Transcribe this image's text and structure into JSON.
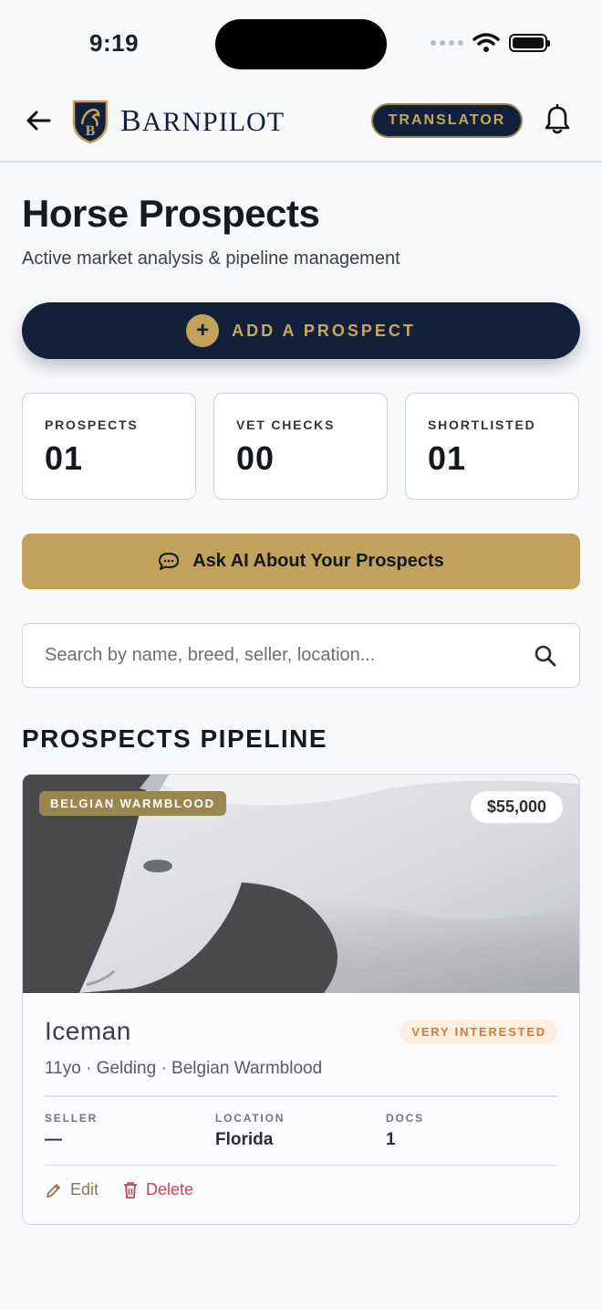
{
  "status_bar": {
    "time": "9:19"
  },
  "header": {
    "logo_text": "BarnPilot",
    "logo_text_first": "B",
    "logo_text_rest": "ARNPILOT",
    "translator_label": "TRANSLATOR",
    "icons": {
      "back": "arrow-left-icon",
      "notifications": "bell-icon",
      "logo": "crest-icon"
    }
  },
  "page": {
    "title": "Horse Prospects",
    "subtitle": "Active market analysis & pipeline management"
  },
  "add_button": {
    "label": "ADD A PROSPECT",
    "icon": "plus-circle-icon"
  },
  "stats": [
    {
      "label": "PROSPECTS",
      "value": "01"
    },
    {
      "label": "VET CHECKS",
      "value": "00"
    },
    {
      "label": "SHORTLISTED",
      "value": "01"
    }
  ],
  "ai_button": {
    "label": "Ask AI About Your Prospects",
    "icon": "chat-bubble-icon"
  },
  "search": {
    "placeholder": "Search by name, breed, seller, location...",
    "value": "",
    "icon": "search-icon"
  },
  "pipeline": {
    "title": "PROSPECTS PIPELINE",
    "items": [
      {
        "breed_badge": "BELGIAN WARMBLOOD",
        "price": "$55,000",
        "name": "Iceman",
        "status": "VERY INTERESTED",
        "meta": "11yo · Gelding · Belgian Warmblood",
        "details": [
          {
            "label": "SELLER",
            "value": "—"
          },
          {
            "label": "LOCATION",
            "value": "Florida"
          },
          {
            "label": "DOCS",
            "value": "1"
          }
        ],
        "actions": {
          "edit": "Edit",
          "delete": "Delete"
        }
      }
    ]
  },
  "colors": {
    "navy": "#13203a",
    "gold": "#c2a25b",
    "gold_text": "#c9a75a",
    "badge_olive": "#9a8650",
    "interest_orange": "#d07a37",
    "delete_red": "#c0475a"
  }
}
